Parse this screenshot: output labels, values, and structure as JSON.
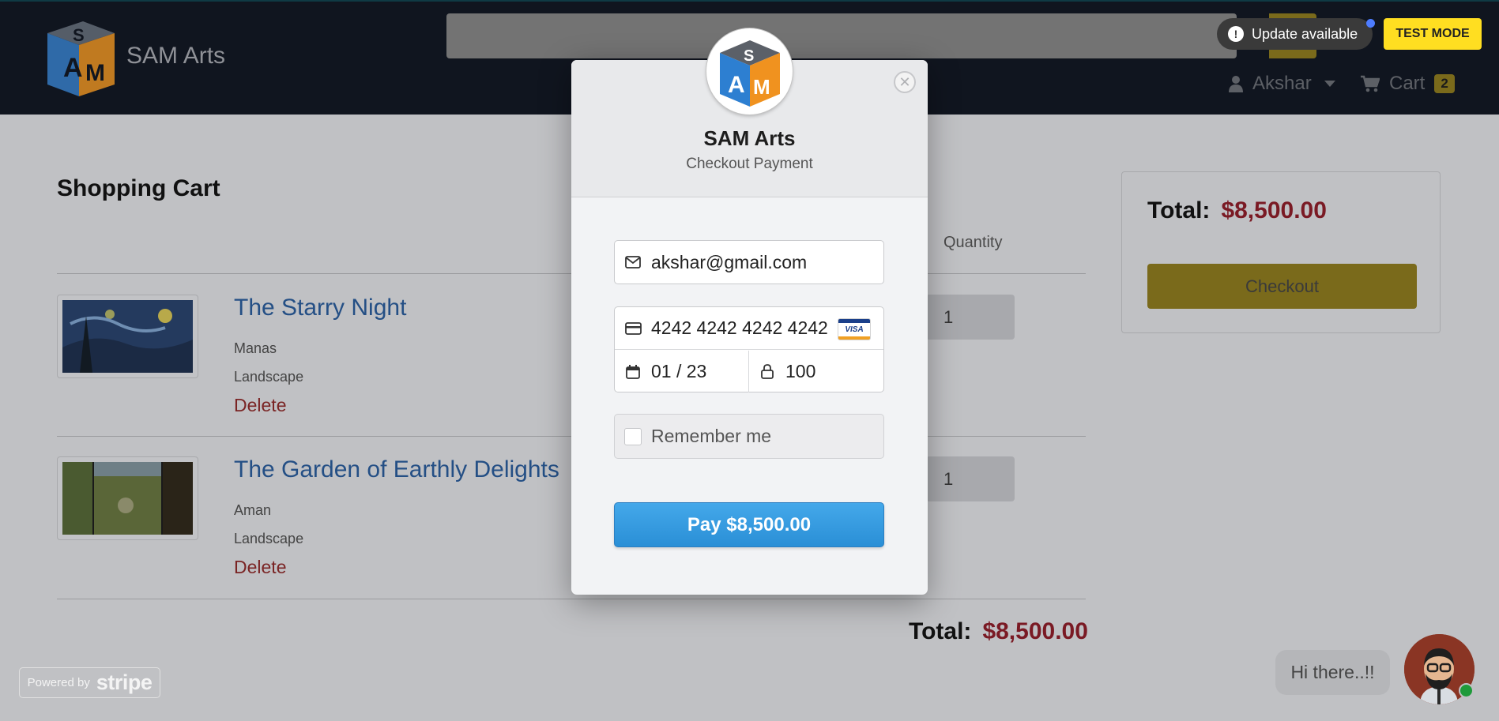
{
  "header": {
    "brand": "SAM Arts",
    "update_label": "Update available",
    "test_mode_label": "TEST MODE",
    "user_name": "Akshar",
    "cart_label": "Cart",
    "cart_count": "2"
  },
  "cart": {
    "heading": "Shopping Cart",
    "quantity_header": "Quantity",
    "items": [
      {
        "title": "The Starry Night",
        "artist": "Manas",
        "category": "Landscape",
        "delete_label": "Delete",
        "quantity": "1"
      },
      {
        "title": "The Garden of Earthly Delights",
        "artist": "Aman",
        "category": "Landscape",
        "delete_label": "Delete",
        "quantity": "1"
      }
    ],
    "total_label": "Total:",
    "total_amount": "$8,500.00"
  },
  "summary": {
    "total_label": "Total:",
    "total_amount": "$8,500.00",
    "checkout_label": "Checkout"
  },
  "stripe_badge": {
    "powered_by": "Powered by",
    "brand": "stripe"
  },
  "chat": {
    "greeting": "Hi there..!!"
  },
  "modal": {
    "title": "SAM Arts",
    "subtitle": "Checkout Payment",
    "close_symbol": "✕",
    "email_value": "akshar@gmail.com",
    "card_number": "4242 4242 4242 4242",
    "card_brand": "VISA",
    "expiry": "01 / 23",
    "cvc": "100",
    "remember_label": "Remember me",
    "pay_label": "Pay $8,500.00"
  },
  "colors": {
    "navbar": "#10151f",
    "accent_yellow": "#ffde21",
    "price_red": "#7a1a24",
    "pay_blue": "#2a8fd6"
  }
}
